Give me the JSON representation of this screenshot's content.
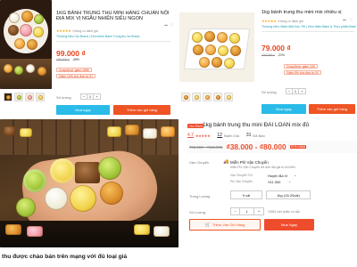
{
  "panel_a": {
    "title": "1KG BÁNH TRUNG THU MINI HÀNG CHUẨN NỘI ĐỊA MIX VỊ NGẪU NHIÊN SIÊU NGON",
    "rating_text": "Không có đánh giá",
    "brand_text": "Thương hiệu: No Brand | Xem thêm Bánh Trung thu No Brand",
    "price": "99.000 ₫",
    "old_price": "158.000 ₫",
    "discount": "-45%",
    "promo": "CrazyDeal: giảm 199K",
    "promo2": "Giảm 10% cho đơn từ 0₫",
    "qty_label": "Số lượng",
    "qty_value": "1",
    "buy_now": "Mua ngay",
    "add_to_cart": "Thêm vào giỏ hàng",
    "share_icon": "share-icon",
    "heart_icon": "heart-icon"
  },
  "panel_b": {
    "title": "1kg bánh trung thu mini mix nhiều vị",
    "rating_text": "Không có đánh giá",
    "brand_text": "Thương hiệu: Bánh Mứt Kẹo Tết | Xem thêm Bánh & Thực phẩm Bánh Mứt Kẹo Tết",
    "price": "79.000 ₫",
    "old_price": "100.000 ₫",
    "discount": "-21%",
    "promo": "CrazyDeal: giảm 10K",
    "promo2": "Giảm 5% cho đơn từ 0₫",
    "qty_label": "Số lượng",
    "qty_value": "1",
    "buy_now": "Mua ngay",
    "add_to_cart": "Thêm vào giỏ hàng",
    "share_icon": "share-icon",
    "heart_icon": "heart-icon"
  },
  "panel_c": {
    "mall_badge": "Yêu Thích",
    "title": "1kg bánh trung thu mini ĐÀI LOAN mix đủ",
    "rating": "4.7",
    "rating_count": "12",
    "rating_count_label": "Đánh Giá",
    "sold_count": "31",
    "sold_label": "Đã Bán",
    "old_price": "₫50.000 - ₫110.000",
    "price": "₫38.000 - ₫80.000",
    "discount": "37% GIẢM",
    "shipping_label": "Vận Chuyển",
    "free_ship": "Miễn Phí Vận Chuyển",
    "free_ship_sub": "Miễn Phí Vận Chuyển khi đơn đạt giá trị tối thiểu",
    "ship_to_label": "Vận Chuyển Tới",
    "ship_to_value": "Huyện Ba Vì",
    "ship_fee_label": "Phí Vận Chuyển",
    "ship_fee_value": "₫41.300",
    "weight_label": "Trọng Lượng",
    "weight_options": [
      "9 cái",
      "1kg (15-20cái)"
    ],
    "qty_label": "Số Lượng",
    "qty_value": "1",
    "stock_text": "10581 sản phẩm có sẵn",
    "add_to_cart": "Thêm Vào Giỏ Hàng",
    "buy_now": "Mua Ngay",
    "cart_icon": "cart-icon",
    "truck_icon": "truck-icon"
  },
  "caption": "thu được chào bán trên mạng với đủ loại giá",
  "colors": {
    "accent": "#ee5424",
    "price": "#e8451e",
    "star": "#f5a623",
    "shopee_red": "#ee4d2d"
  }
}
